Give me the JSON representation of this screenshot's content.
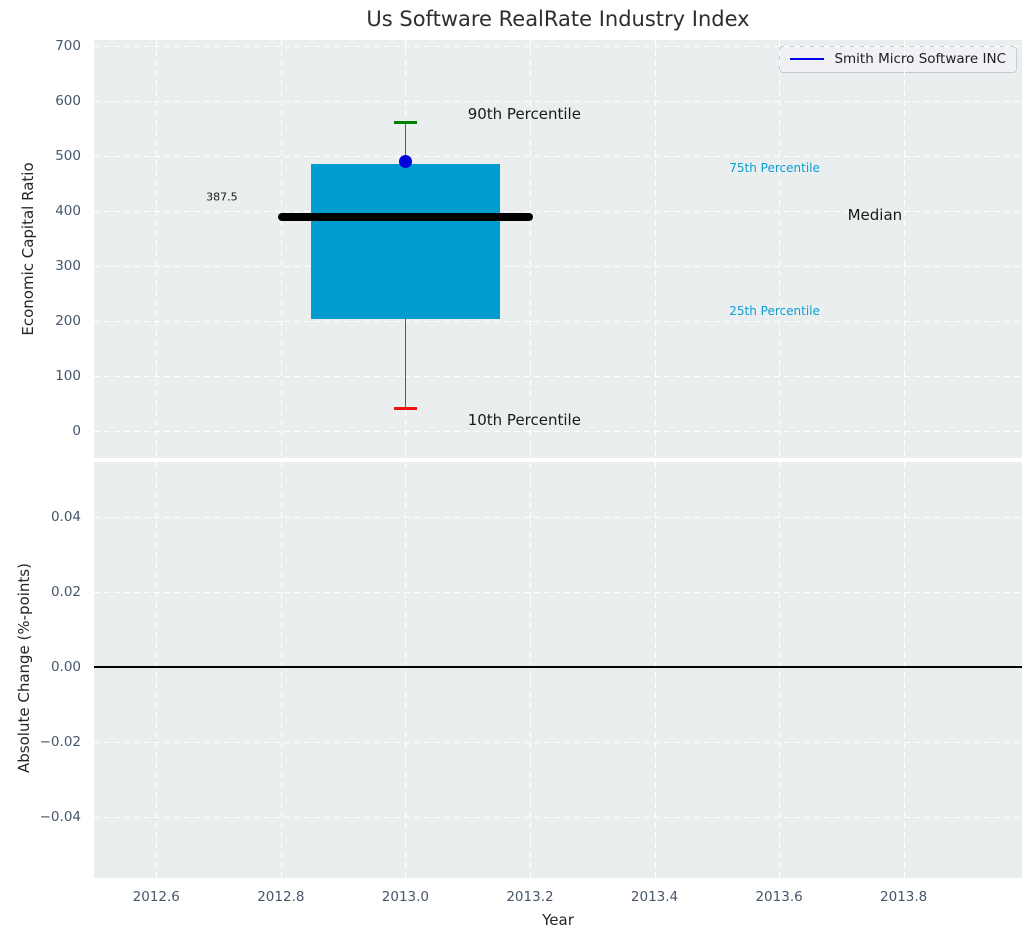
{
  "figure": {
    "title": "Us Software RealRate Industry Index"
  },
  "legend": {
    "label": "Smith Micro Software INC"
  },
  "colors": {
    "box_fill": "#029dd0",
    "median_line": "#000000",
    "whisker": "#5a5a5a",
    "cap_90": "#008000",
    "cap_10": "#ee1111",
    "company_dot": "#0000dd",
    "legend_line": "#0000ee",
    "axes_bg": "#ebeeef",
    "grid": "#ffffff",
    "tick_label": "#46566b",
    "text": "#262626",
    "percentile_text": "#0d9ed3",
    "zero_line": "#000000"
  },
  "chart_data": [
    {
      "type": "boxplot",
      "title": "Us Software RealRate Industry Index",
      "ylabel": "Economic Capital Ratio",
      "ylim": [
        -50,
        710
      ],
      "xlim": [
        2012.5,
        2013.99
      ],
      "grid": true,
      "yticks": [
        {
          "v": 0,
          "label": "0"
        },
        {
          "v": 100,
          "label": "100"
        },
        {
          "v": 200,
          "label": "200"
        },
        {
          "v": 300,
          "label": "300"
        },
        {
          "v": 400,
          "label": "400"
        },
        {
          "v": 500,
          "label": "500"
        },
        {
          "v": 600,
          "label": "600"
        },
        {
          "v": 700,
          "label": "700"
        }
      ],
      "series": [
        {
          "name": "Smith Micro Software INC",
          "x": 2013.0,
          "p10": 40,
          "p25": 203,
          "median": 387.5,
          "p75": 485,
          "p90": 560,
          "company_value": 490,
          "median_label": "387.5",
          "box_halfwidth": 0.152,
          "median_halfwidth": 0.205,
          "cap_halfwidth": 0.0185
        }
      ],
      "legend": {
        "label": "Smith Micro Software INC",
        "position": "upper right"
      },
      "annotations": [
        {
          "text": "90th Percentile",
          "x": 2013.1,
          "y": 576,
          "size": 15,
          "color": "#1a1a1a"
        },
        {
          "text": "75th Percentile",
          "x": 2013.52,
          "y": 478,
          "size": 12,
          "color": "#0d9ed3"
        },
        {
          "text": "Median",
          "x": 2013.71,
          "y": 391,
          "size": 15,
          "color": "#1a1a1a"
        },
        {
          "text": "387.5",
          "x": 2012.68,
          "y": 424,
          "size": 11,
          "color": "#1a1a1a"
        },
        {
          "text": "25th Percentile",
          "x": 2013.52,
          "y": 218,
          "size": 12,
          "color": "#0d9ed3"
        },
        {
          "text": "10th Percentile",
          "x": 2013.1,
          "y": 20,
          "size": 15,
          "color": "#1a1a1a"
        }
      ]
    },
    {
      "type": "line",
      "ylabel": "Absolute Change (%-points)",
      "xlabel": "Year",
      "ylim": [
        -0.0563,
        0.0547
      ],
      "xlim": [
        2012.5,
        2013.99
      ],
      "grid": true,
      "yticks": [
        {
          "v": 0.04,
          "label": "0.04"
        },
        {
          "v": 0.02,
          "label": "0.02"
        },
        {
          "v": 0.0,
          "label": "0.00"
        },
        {
          "v": -0.02,
          "label": "−0.02"
        },
        {
          "v": -0.04,
          "label": "−0.04"
        }
      ],
      "xticks": [
        {
          "v": 2012.6,
          "label": "2012.6"
        },
        {
          "v": 2012.8,
          "label": "2012.8"
        },
        {
          "v": 2013.0,
          "label": "2013.0"
        },
        {
          "v": 2013.2,
          "label": "2013.2"
        },
        {
          "v": 2013.4,
          "label": "2013.4"
        },
        {
          "v": 2013.6,
          "label": "2013.6"
        },
        {
          "v": 2013.8,
          "label": "2013.8"
        }
      ],
      "series": [
        {
          "name": "Smith Micro Software INC",
          "y_constant": 0.0
        }
      ],
      "zero_line": 0.0
    }
  ]
}
